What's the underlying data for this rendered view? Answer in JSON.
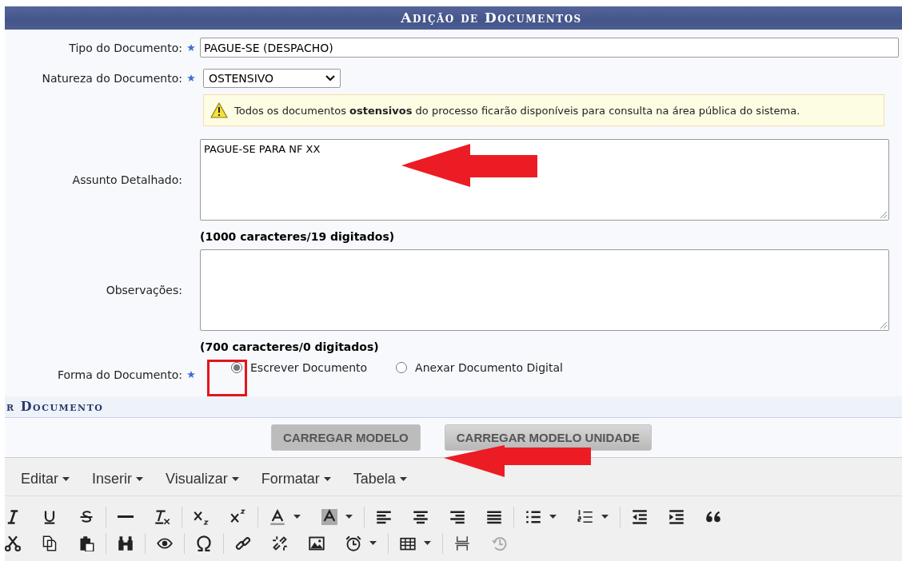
{
  "panel": {
    "title": "Adição de Documentos"
  },
  "tipo": {
    "label": "Tipo do Documento:",
    "required": true,
    "value": "PAGUE-SE (DESPACHO)"
  },
  "natureza": {
    "label": "Natureza do Documento:",
    "required": true,
    "value": "OSTENSIVO"
  },
  "notice": {
    "text": "Todos os documentos **ostensivos** do processo ficarão disponíveis para consulta na área pública do sistema."
  },
  "assunto": {
    "label": "Assunto Detalhado:",
    "value": "PAGUE-SE PARA NF XX",
    "counter": "(1000 caracteres/19 digitados)"
  },
  "observacoes": {
    "label": "Observações:",
    "counter": "(700 caracteres/0 digitados)"
  },
  "forma": {
    "label": "Forma do Documento:",
    "required": true,
    "options": [
      {
        "label": "Escrever Documento",
        "selected": true
      },
      {
        "label": "Anexar Documento Digital",
        "selected": false
      }
    ]
  },
  "section": {
    "title": "r Documento"
  },
  "buttons": [
    "CARREGAR MODELO",
    "CARREGAR MODELO UNIDADE"
  ],
  "editor": {
    "menus": [
      "Editar",
      "Inserir",
      "Visualizar",
      "Formatar",
      "Tabela"
    ]
  }
}
